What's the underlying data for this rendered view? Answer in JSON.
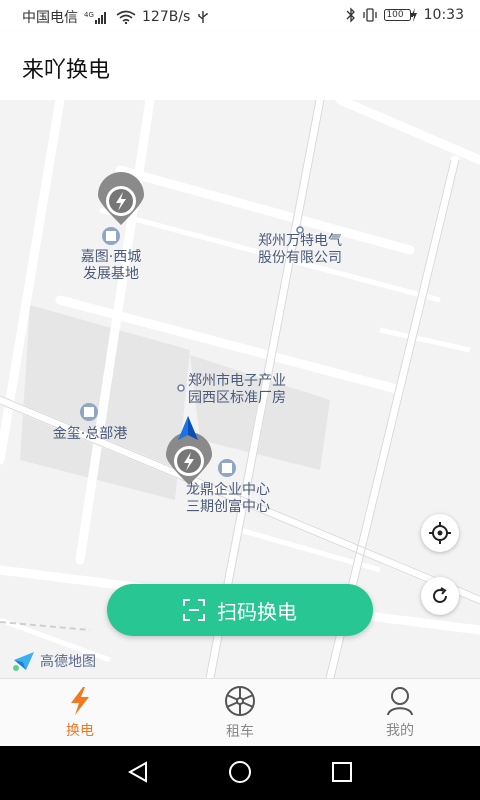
{
  "status_bar": {
    "carrier": "中国电信",
    "network_speed": "127B/s",
    "battery": "100",
    "time": "10:33"
  },
  "header": {
    "title": "来吖换电"
  },
  "map": {
    "pois": [
      {
        "name": "嘉图·西城发展基地",
        "line1": "嘉图·西城",
        "line2": "发展基地"
      },
      {
        "name": "郑州万特电气股份有限公司",
        "line1": "郑州万特电气",
        "line2": "股份有限公司"
      },
      {
        "name": "郑州市电子产业园西区标准厂房",
        "line1": "郑州市电子产业",
        "line2": "园西区标准厂房"
      },
      {
        "name": "金玺·总部港",
        "line1": "金玺·总部港",
        "line2": ""
      },
      {
        "name": "龙鼎企业中心三期创富中心",
        "line1": "龙鼎企业中心",
        "line2": "三期创富中心"
      }
    ],
    "logo_text": "高德地图"
  },
  "actions": {
    "scan_button_label": "扫码换电"
  },
  "tabs": [
    {
      "label": "换电",
      "active": true
    },
    {
      "label": "租车",
      "active": false
    },
    {
      "label": "我的",
      "active": false
    }
  ],
  "colors": {
    "accent": "#27c693",
    "tab_active": "#f07a22"
  }
}
